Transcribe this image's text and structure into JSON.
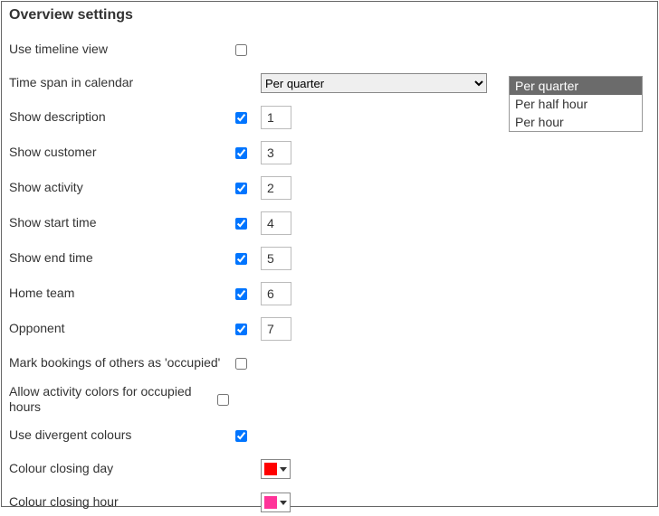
{
  "title": "Overview settings",
  "timespan": {
    "options": [
      "Per quarter",
      "Per half hour",
      "Per hour"
    ],
    "selected": "Per quarter"
  },
  "rows": {
    "use_timeline": {
      "label": "Use timeline view",
      "checked": false
    },
    "time_span": {
      "label": "Time span in calendar"
    },
    "show_desc": {
      "label": "Show description",
      "checked": true,
      "value": "1"
    },
    "show_customer": {
      "label": "Show customer",
      "checked": true,
      "value": "3"
    },
    "show_activity": {
      "label": "Show activity",
      "checked": true,
      "value": "2"
    },
    "show_start": {
      "label": "Show start time",
      "checked": true,
      "value": "4"
    },
    "show_end": {
      "label": "Show end time",
      "checked": true,
      "value": "5"
    },
    "home_team": {
      "label": "Home team",
      "checked": true,
      "value": "6"
    },
    "opponent": {
      "label": "Opponent",
      "checked": true,
      "value": "7"
    },
    "mark_occupied": {
      "label": "Mark bookings of others as 'occupied'",
      "checked": false
    },
    "allow_colors": {
      "label": "Allow activity colors for occupied hours",
      "checked": false
    },
    "use_divergent": {
      "label": "Use divergent colours",
      "checked": true
    },
    "closing_day": {
      "label": "Colour closing day",
      "color": "#ff0000"
    },
    "closing_hour": {
      "label": "Colour closing hour",
      "color": "#ff3399"
    }
  }
}
